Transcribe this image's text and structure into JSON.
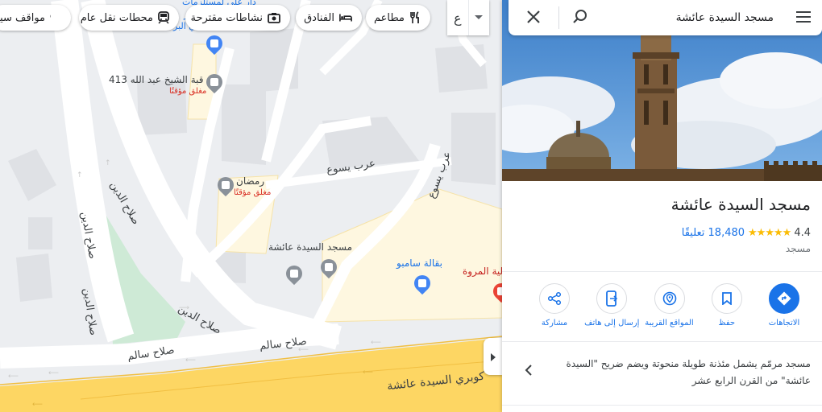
{
  "map": {
    "chips": [
      {
        "label": "مواقف سيا",
        "icon": "parking-icon"
      },
      {
        "label": "محطات نقل عام",
        "icon": "transit-icon"
      },
      {
        "label": "نشاطات مقترحة",
        "icon": "camera-icon"
      },
      {
        "label": "الفنادق",
        "icon": "hotel-icon"
      },
      {
        "label": "مطاعم",
        "icon": "restaurant-icon"
      }
    ],
    "layer_button_label": "ع",
    "labels": {
      "top_partial": "دار علي لمستلزمات",
      "top_partial2": "فر",
      "top_partial3": "الي البر",
      "dome": "قبة الشيخ عبد الله 413",
      "dome_status": "مغلق مؤقتًا",
      "ramadan": "رمضان",
      "ramadan_status": "مغلق مؤقتًا",
      "mosque": "مسجد السيدة عائشة",
      "sambo": "بقالة سامبو",
      "marwa": "لية المروة"
    },
    "roads": {
      "arab_yasou1": "عرب يسوع",
      "arab_yasou2": "عرب يسوع",
      "salah1": "صلاح الدين",
      "salah2": "صلاح الدين",
      "salah3": "صلاح الدين",
      "salah4": "صلاح الدين",
      "salem1": "صلاح سالم",
      "salem2": "صلاح سالم",
      "bridge": "كوبري السيدة عائشة"
    }
  },
  "panel": {
    "search_value": "مسجد السيدة عائشة",
    "title": "مسجد السيدة عائشة",
    "rating": "4.4",
    "stars": "★★★★★",
    "reviews": "18,480 تعليقًا",
    "category": "مسجد",
    "actions": [
      {
        "label": "الاتجاهات",
        "icon": "directions-icon"
      },
      {
        "label": "حفظ",
        "icon": "bookmark-icon"
      },
      {
        "label": "المواقع القريبة",
        "icon": "nearby-icon"
      },
      {
        "label": "إرسال إلى هاتف",
        "icon": "send-to-phone-icon"
      },
      {
        "label": "مشاركة",
        "icon": "share-icon"
      }
    ],
    "description": "مسجد مرمّم يشمل مئذنة طويلة منحوتة ويضم ضريح \"السيدة عائشة\" من القرن الرابع عشر"
  },
  "colors": {
    "accent": "#1a73e8",
    "star": "#fbbc04",
    "road_major": "#fdd663",
    "park": "#ceead6",
    "highlight_area": "#fef7e0"
  }
}
